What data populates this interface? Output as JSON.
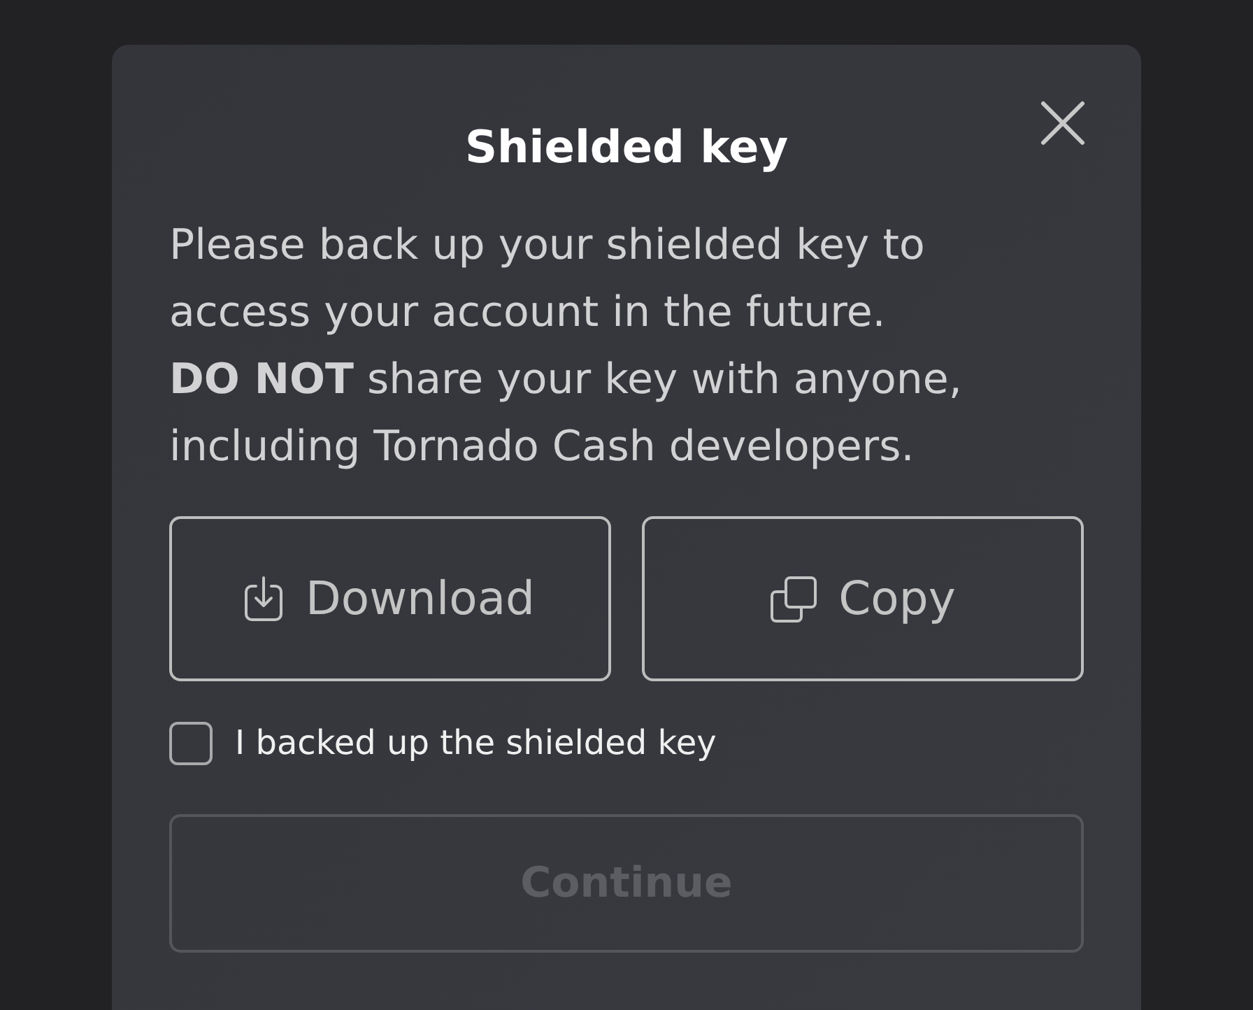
{
  "dialog": {
    "title": "Shielded key",
    "message": [
      "Please back up your shielded key to access your account in the future.",
      "**DO NOT** share your key with anyone, including Tornado Cash developers."
    ],
    "actions": [
      {
        "kind": "download",
        "label": "Download"
      },
      {
        "kind": "copy",
        "label": "Copy"
      }
    ],
    "checkbox": {
      "label": "I backed up the shielded key",
      "checked": false
    },
    "continue_button": {
      "label": "Continue",
      "disabled": true
    }
  }
}
